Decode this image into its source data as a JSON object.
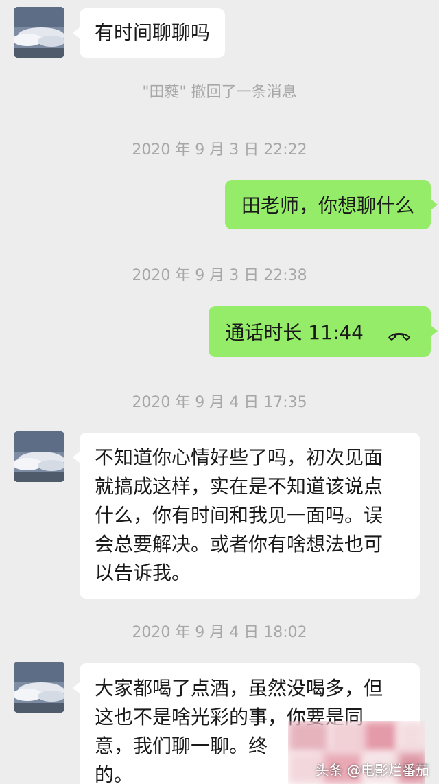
{
  "messages": {
    "m1": "有时间聊聊吗",
    "recall": "\"田蕤\" 撤回了一条消息",
    "ts1": "2020 年 9 月 3 日 22:22",
    "m2": "田老师，你想聊什么",
    "ts2": "2020 年 9 月 3 日 22:38",
    "call_label": "通话时长 11:44",
    "ts3": "2020 年 9 月 4 日 17:35",
    "m3_lines": [
      "不知道你心情好些了吗，初次见面",
      "就搞成这样，实在是不知道该说点",
      "什么，你有时间和我见一面吗。误",
      "会总要解决。或者你有啥想法也可",
      "以告诉我。"
    ],
    "ts4": "2020 年 9 月 4 日 18:02",
    "m4_lines": [
      "大家都喝了点酒，虽然没喝多，但",
      "这也不是啥光彩的事，你要是同",
      "意，我们聊一聊。终",
      "的。"
    ]
  },
  "watermark": "头条 @电影烂番茄",
  "colors": {
    "background": "#ededed",
    "incoming_bubble": "#ffffff",
    "outgoing_bubble": "#95ec69",
    "meta_text": "#a7a7a7"
  },
  "icons": {
    "call": "phone-hangup-icon",
    "avatar": "sky-clouds-avatar"
  }
}
